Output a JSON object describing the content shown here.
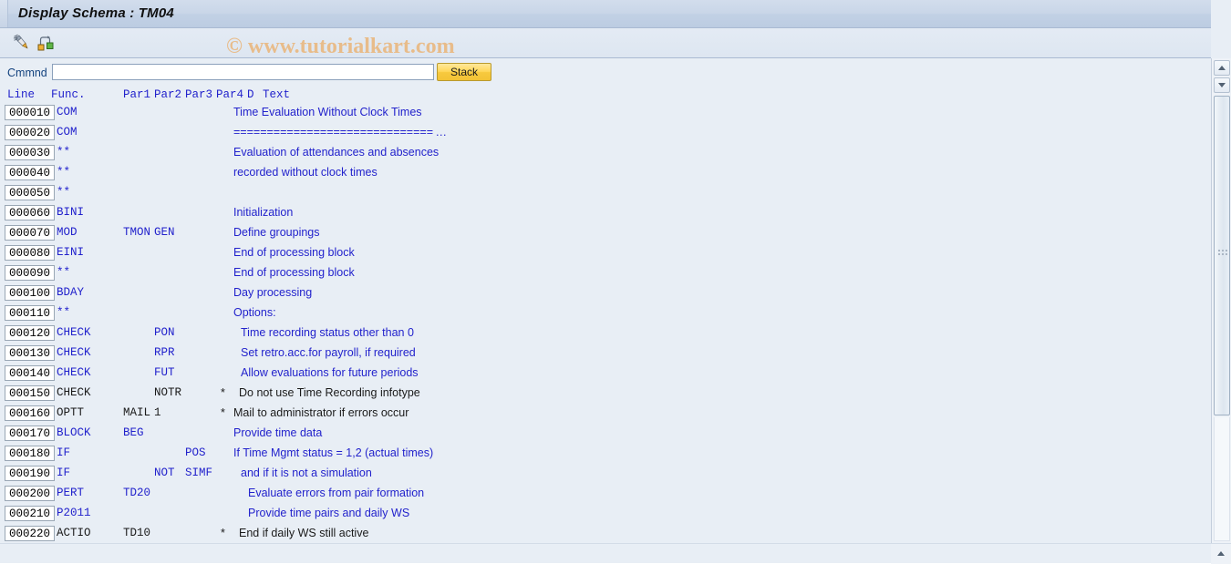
{
  "window": {
    "title": "Display Schema : TM04"
  },
  "watermark": "© www.tutorialkart.com",
  "toolbar": {
    "buttons": [
      {
        "name": "edit-schema-icon",
        "tooltip": "Display <-> Change"
      },
      {
        "name": "hierarchy-icon",
        "tooltip": "Schema hierarchy"
      }
    ]
  },
  "command": {
    "label": "Cmmnd",
    "value": "",
    "placeholder": "",
    "stack_label": "Stack"
  },
  "grid": {
    "columns": [
      "Line",
      "Func.",
      "Par1",
      "Par2",
      "Par3",
      "Par4",
      "D",
      "Text"
    ],
    "rows": [
      {
        "line": "000010",
        "func": "COM",
        "p1": "",
        "p2": "",
        "p3": "",
        "p4": "",
        "d": "",
        "text": "Time Evaluation Without Clock Times",
        "color": "blue"
      },
      {
        "line": "000020",
        "func": "COM",
        "p1": "",
        "p2": "",
        "p3": "",
        "p4": "",
        "d": "",
        "text": "============================== …",
        "color": "blue"
      },
      {
        "line": "000030",
        "func": "**",
        "p1": "",
        "p2": "",
        "p3": "",
        "p4": "",
        "d": "",
        "text": "Evaluation of attendances and absences",
        "color": "blue"
      },
      {
        "line": "000040",
        "func": "**",
        "p1": "",
        "p2": "",
        "p3": "",
        "p4": "",
        "d": "",
        "text": "recorded without clock times",
        "color": "blue"
      },
      {
        "line": "000050",
        "func": "**",
        "p1": "",
        "p2": "",
        "p3": "",
        "p4": "",
        "d": "",
        "text": "",
        "color": "blue"
      },
      {
        "line": "000060",
        "func": "BINI",
        "p1": "",
        "p2": "",
        "p3": "",
        "p4": "",
        "d": "",
        "text": "Initialization",
        "color": "blue"
      },
      {
        "line": "000070",
        "func": "MOD",
        "p1": "TMON",
        "p2": "GEN",
        "p3": "",
        "p4": "",
        "d": "",
        "text": "Define groupings",
        "color": "blue"
      },
      {
        "line": "000080",
        "func": "EINI",
        "p1": "",
        "p2": "",
        "p3": "",
        "p4": "",
        "d": "",
        "text": "End of processing block",
        "color": "blue"
      },
      {
        "line": "000090",
        "func": "**",
        "p1": "",
        "p2": "",
        "p3": "",
        "p4": "",
        "d": "",
        "text": "End of processing block",
        "color": "blue"
      },
      {
        "line": "000100",
        "func": "BDAY",
        "p1": "",
        "p2": "",
        "p3": "",
        "p4": "",
        "d": "",
        "text": "Day processing",
        "color": "blue"
      },
      {
        "line": "000110",
        "func": "**",
        "p1": "",
        "p2": "",
        "p3": "",
        "p4": "",
        "d": "",
        "text": "Options:",
        "color": "blue"
      },
      {
        "line": "000120",
        "func": "CHECK",
        "p1": "",
        "p2": "PON",
        "p3": "",
        "p4": "",
        "d": "",
        "text": "Time recording status other than 0",
        "color": "blue"
      },
      {
        "line": "000130",
        "func": "CHECK",
        "p1": "",
        "p2": "RPR",
        "p3": "",
        "p4": "",
        "d": "",
        "text": "Set retro.acc.for payroll, if required",
        "color": "blue"
      },
      {
        "line": "000140",
        "func": "CHECK",
        "p1": "",
        "p2": "FUT",
        "p3": "",
        "p4": "",
        "d": "",
        "text": "Allow evaluations for future periods",
        "color": "blue"
      },
      {
        "line": "000150",
        "func": "CHECK",
        "p1": "",
        "p2": "NOTR",
        "p3": "",
        "p4": "",
        "d": "*",
        "text": "Do not use Time Recording infotype",
        "color": "black"
      },
      {
        "line": "000160",
        "func": "OPTT",
        "p1": "MAIL",
        "p2": "1",
        "p3": "",
        "p4": "",
        "d": "*",
        "text": "Mail to administrator if errors occur",
        "color": "black"
      },
      {
        "line": "000170",
        "func": "BLOCK",
        "p1": "BEG",
        "p2": "",
        "p3": "",
        "p4": "",
        "d": "",
        "text": "Provide time data",
        "color": "blue"
      },
      {
        "line": "000180",
        "func": "IF",
        "p1": "",
        "p2": "",
        "p3": "POS",
        "p4": "",
        "d": "",
        "text": "If Time Mgmt status = 1,2 (actual times)",
        "color": "blue"
      },
      {
        "line": "000190",
        "func": "IF",
        "p1": "",
        "p2": "NOT",
        "p3": "SIMF",
        "p4": "",
        "d": "",
        "text": "and if it is not a simulation",
        "color": "blue"
      },
      {
        "line": "000200",
        "func": "PERT",
        "p1": "TD20",
        "p2": "",
        "p3": "",
        "p4": "",
        "d": "",
        "text": "Evaluate errors from pair formation",
        "color": "blue"
      },
      {
        "line": "000210",
        "func": "P2011",
        "p1": "",
        "p2": "",
        "p3": "",
        "p4": "",
        "d": "",
        "text": "Provide time pairs and daily WS",
        "color": "blue"
      },
      {
        "line": "000220",
        "func": "ACTIO",
        "p1": "TD10",
        "p2": "",
        "p3": "",
        "p4": "",
        "d": "*",
        "text": "End if daily WS still active",
        "color": "black"
      },
      {
        "line": "",
        "func": "",
        "p1": "",
        "p2": "",
        "p3": "",
        "p4": "",
        "d": "",
        "text": "",
        "color": "blue"
      }
    ],
    "text_indent": {
      "000010": 0,
      "000020": 0,
      "000030": 0,
      "000040": 0,
      "000050": 0,
      "000060": 0,
      "000070": 0,
      "000080": 0,
      "000090": 0,
      "000100": 0,
      "000110": 0,
      "000120": 8,
      "000130": 8,
      "000140": 8,
      "000150": 6,
      "000160": 0,
      "000170": 0,
      "000180": 0,
      "000190": 8,
      "000200": 16,
      "000210": 16,
      "000220": 6
    }
  },
  "scrollbars": {
    "vertical_position": "top",
    "horizontal_position": "left"
  },
  "colors": {
    "title_bar": "#c7d4e6",
    "accent_blue": "#2222cc",
    "link_label": "#14437f",
    "stack_button": "#ffd758",
    "watermark": "#e8bc8a",
    "background": "#e8eef5"
  }
}
